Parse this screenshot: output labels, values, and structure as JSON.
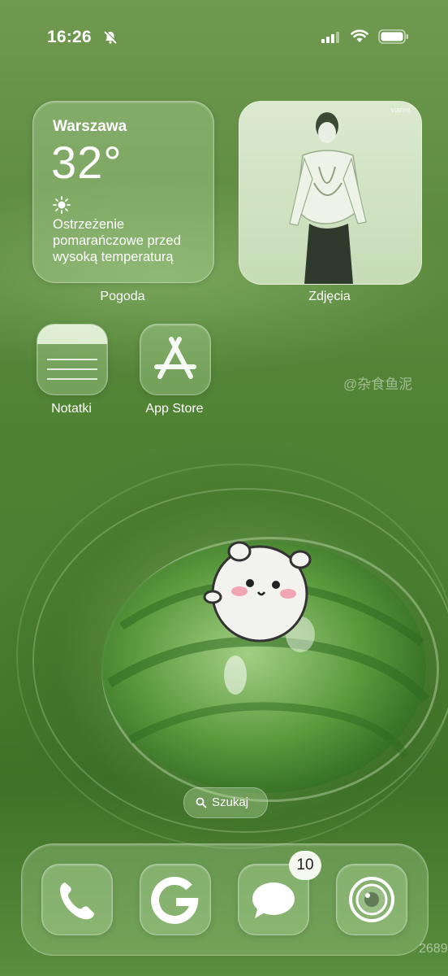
{
  "status_bar": {
    "time": "16:26"
  },
  "widgets": {
    "weather": {
      "city": "Warszawa",
      "temperature": "32°",
      "description": "Ostrzeżenie pomarańczowe przed wysoką temperaturą",
      "label": "Pogoda"
    },
    "photos": {
      "label": "Zdjęcia",
      "watermark": "vianni"
    }
  },
  "apps": [
    {
      "label": "Notatki",
      "icon": "notes-icon"
    },
    {
      "label": "App Store",
      "icon": "app-store-icon"
    }
  ],
  "wallpaper_watermark": "@杂食鱼泥",
  "search": {
    "label": "Szukaj"
  },
  "dock": {
    "apps": [
      {
        "icon": "phone-icon"
      },
      {
        "icon": "google-icon"
      },
      {
        "icon": "messages-icon",
        "badge": "10"
      },
      {
        "icon": "camera-icon"
      }
    ]
  },
  "corner_watermark": "2689"
}
